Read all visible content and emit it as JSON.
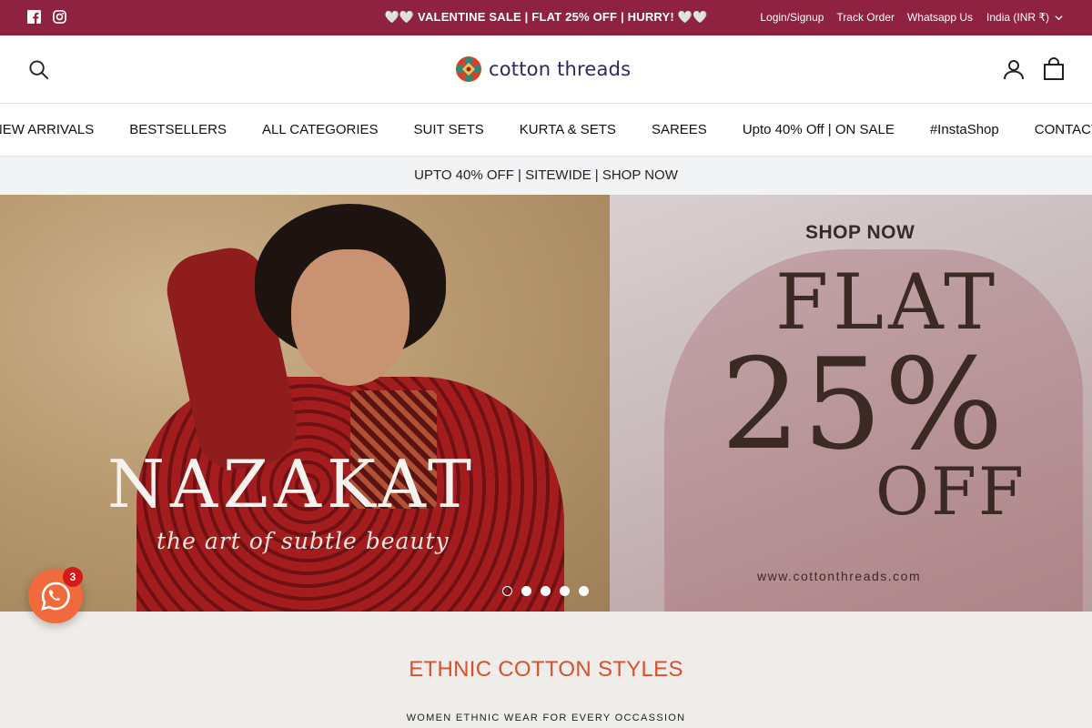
{
  "topbar": {
    "promo": "🤍🤍 VALENTINE SALE | FLAT 25% OFF | HURRY! 🤍🤍",
    "social_icons": [
      "facebook-icon",
      "instagram-icon"
    ],
    "links": {
      "login": "Login/Signup",
      "track": "Track Order",
      "whatsapp": "Whatsapp Us",
      "country": "India (INR ₹)"
    },
    "background": "#8e2240"
  },
  "header": {
    "logo_text": "cotton threads",
    "icons": [
      "search-icon",
      "account-icon",
      "cart-icon"
    ]
  },
  "nav": {
    "items": [
      "NEW ARRIVALS",
      "BESTSELLERS",
      "ALL CATEGORIES",
      "SUIT SETS",
      "KURTA & SETS",
      "SAREES",
      "Upto 40% Off | ON SALE",
      "#InstaShop",
      "CONTACT"
    ]
  },
  "strip": {
    "text": "UPTO 40% OFF | SITEWIDE | SHOP NOW"
  },
  "hero": {
    "title": "NAZAKAT",
    "tagline": "the art of subtle beauty",
    "shop_now": "SHOP NOW",
    "flat": "FLAT",
    "percent": "25%",
    "off": "OFF",
    "url": "www.cottonthreads.com",
    "slide_count": 5,
    "active_slide": 1
  },
  "section": {
    "heading": "ETHNIC COTTON STYLES",
    "subheading": "WOMEN ETHNIC WEAR FOR EVERY OCCASSION",
    "accent": "#d8502c"
  },
  "chat": {
    "badge": "3",
    "icon": "whatsapp-icon",
    "color": "#f06a3c"
  }
}
